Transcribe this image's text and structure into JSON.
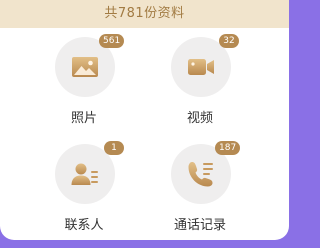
{
  "header": {
    "title": "共781份资料"
  },
  "items": [
    {
      "label": "照片",
      "badge": "561",
      "icon": "photo-icon"
    },
    {
      "label": "视频",
      "badge": "32",
      "icon": "video-icon"
    },
    {
      "label": "联系人",
      "badge": "1",
      "icon": "contact-icon"
    },
    {
      "label": "通话记录",
      "badge": "187",
      "icon": "phone-call-icon"
    }
  ],
  "colors": {
    "accent_gold": "#b58a52",
    "header_bg": "#f1e4cc",
    "header_text": "#a27b43",
    "page_bg": "#8a70e6"
  }
}
